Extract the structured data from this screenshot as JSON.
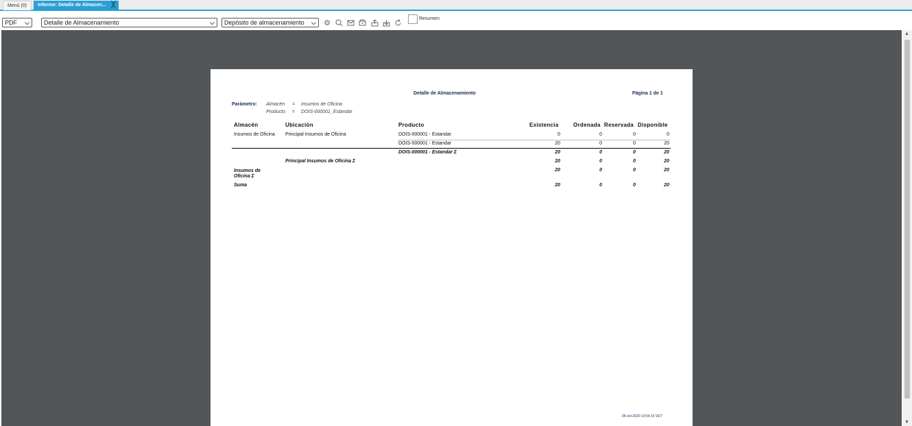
{
  "tabs": {
    "menu": "Menú (0)",
    "active": "Informe: Detalle de Almacen...",
    "close": "╳"
  },
  "toolbar": {
    "format": "PDF",
    "report": "Detalle de Almacenamiento",
    "view": "Depósito de almacenamiento",
    "summary_label": "Resumen",
    "icons": [
      "settings-icon",
      "search-icon",
      "send-mail-icon",
      "archive-icon",
      "export-icon",
      "download-icon",
      "refresh-icon"
    ]
  },
  "report": {
    "title": "Detalle de Almacenamiento",
    "page": "Página 1 de 1",
    "param_label": "Parámetro:",
    "params": [
      {
        "name": "Almacén",
        "eq": "=",
        "value": "Insumos de Oficina"
      },
      {
        "name": "Producto",
        "eq": "=",
        "value": "DOIS-000001_Estandar"
      }
    ],
    "columns": [
      "Almacén",
      "Ubicación",
      "Producto",
      "Existencia",
      "Ordenada",
      "Reservada",
      "Disponible"
    ],
    "rows": [
      {
        "almacen": "Insumos de Oficina",
        "ubicacion": "Principal Insumos de Oficina",
        "producto": "DOIS-000001  - Estandar",
        "existencia": "0",
        "ordenada": "0",
        "reservada": "0",
        "disponible": "0"
      },
      {
        "almacen": "",
        "ubicacion": "",
        "producto": "DOIS-000001  - Estandar",
        "existencia": "20",
        "ordenada": "0",
        "reservada": "0",
        "disponible": "20"
      }
    ],
    "subtotal_product": {
      "label": "DOIS-000001 - Estandar Σ",
      "existencia": "20",
      "ordenada": "0",
      "reservada": "0",
      "disponible": "20"
    },
    "subtotal_location": {
      "label": "Principal Insumos de Oficina Σ",
      "existencia": "20",
      "ordenada": "0",
      "reservada": "0",
      "disponible": "20"
    },
    "subtotal_warehouse": {
      "label_line1": "Insumos de",
      "label_line2": "Oficina Σ",
      "existencia": "20",
      "ordenada": "0",
      "reservada": "0",
      "disponible": "20"
    },
    "total": {
      "label": "Suma",
      "existencia": "20",
      "ordenada": "0",
      "reservada": "0",
      "disponible": "20"
    },
    "footer_timestamp": "05-oct-2020 10:54:15 VET"
  },
  "colors": {
    "accent": "#2a9fd6",
    "viewer_bg": "#525659",
    "report_navy": "#1c2a5a"
  }
}
